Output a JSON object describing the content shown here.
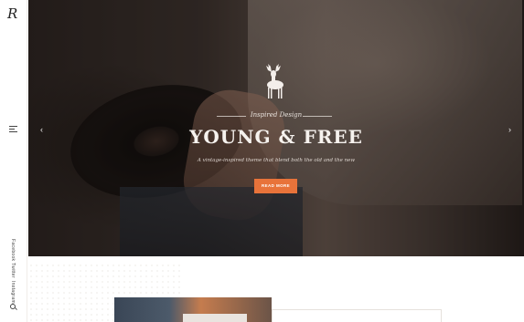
{
  "brand": {
    "logo_letter": "R"
  },
  "sidebar": {
    "social": [
      "Facebook",
      "Twitter",
      "Instagram"
    ]
  },
  "hero": {
    "eyebrow": "Inspired Design",
    "headline": "YOUNG & FREE",
    "subtitle": "A vintage-inspired theme that blend both the old and the new",
    "cta_label": "READ MORE",
    "prev_arrow": "‹",
    "next_arrow": "›"
  },
  "colors": {
    "accent": "#e8733a",
    "text_light": "#f6f2ee",
    "rail_bg": "#ffffff"
  },
  "icons": [
    "menu-icon",
    "deer-icon",
    "search-icon",
    "chevron-left-icon",
    "chevron-right-icon"
  ]
}
